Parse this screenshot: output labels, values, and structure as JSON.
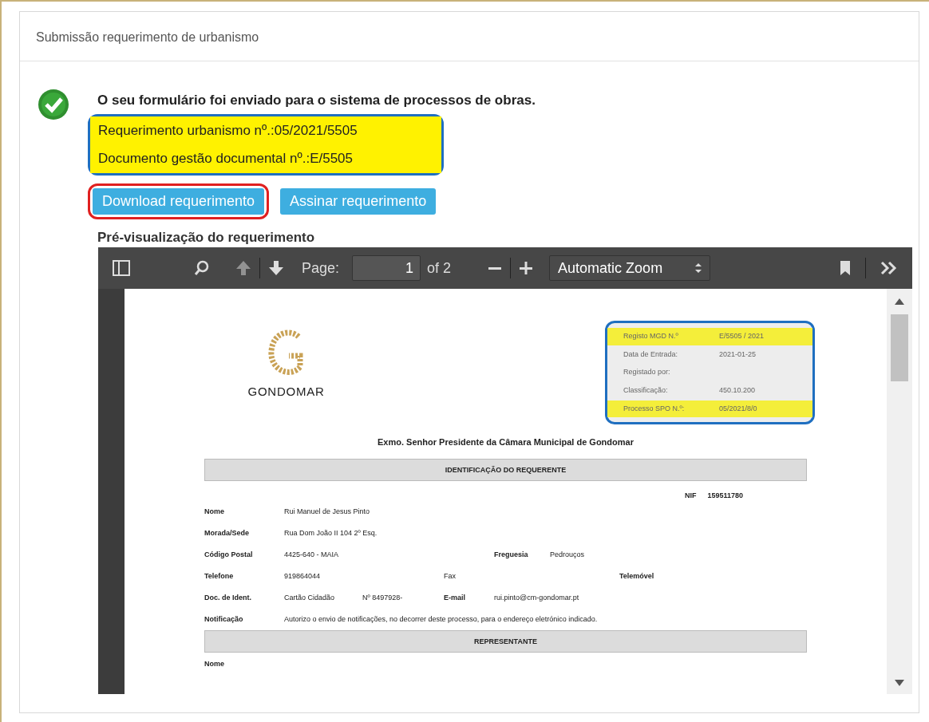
{
  "panel": {
    "title": "Submissão requerimento de urbanismo"
  },
  "result": {
    "message": "O seu formulário foi enviado para o sistema de processos de obras.",
    "references": [
      {
        "text": "Requerimento urbanismo nº.:05/2021/5505",
        "highlighted": true
      },
      {
        "text": "Documento gestão documental nº.:E/5505",
        "highlighted": true
      }
    ],
    "outlined": true
  },
  "buttons": [
    {
      "label": "Download requerimento",
      "outlined": true
    },
    {
      "label": "Assinar requerimento",
      "outlined": false
    }
  ],
  "preview": {
    "title": "Pré-visualização do requerimento",
    "toolbar": {
      "page_label": "Page:",
      "page": "1",
      "page_count": "of 2",
      "zoom": "Automatic Zoom"
    },
    "document": {
      "logo": "GONDOMAR",
      "registry": [
        {
          "label": "Registo MGD N.º",
          "value": "E/5505 / 2021",
          "highlighted": true
        },
        {
          "label": "Data de Entrada:",
          "value": "2021-01-25",
          "highlighted": false
        },
        {
          "label": "Registado por:",
          "highlighted": false
        },
        {
          "label": "Classificação:",
          "value": "450.10.200",
          "highlighted": false
        },
        {
          "label": "Processo SPO N.º:",
          "value": "05/2021/8/0",
          "highlighted": true
        }
      ],
      "registry_outlined": true,
      "addressee": "Exmo. Senhor Presidente da Câmara Municipal de Gondomar",
      "section_1": "IDENTIFICAÇÃO DO REQUERENTE",
      "nif": {
        "label": "NIF",
        "value": "159511780"
      },
      "rows": [
        [
          {
            "kind": "label",
            "text": "Nome"
          },
          {
            "kind": "value",
            "text": "Rui Manuel de Jesus Pinto"
          }
        ],
        [
          {
            "kind": "label",
            "text": "Morada/Sede"
          },
          {
            "kind": "value",
            "text": "Rua Dom João II 104 2º Esq."
          }
        ],
        [
          {
            "kind": "label",
            "text": "Código Postal"
          },
          {
            "kind": "value",
            "text": "4425-640 - MAIA"
          },
          null,
          null,
          {
            "kind": "label",
            "text": "Freguesia"
          },
          {
            "kind": "value",
            "text": "Pedrouços"
          }
        ],
        [
          {
            "kind": "label",
            "text": "Telefone"
          },
          {
            "kind": "value",
            "text": "919864044"
          },
          null,
          {
            "kind": "value",
            "text": "Fax"
          },
          null,
          null,
          {
            "kind": "label",
            "text": "Telemóvel"
          }
        ],
        [
          {
            "kind": "label",
            "text": "Doc. de Ident."
          },
          {
            "kind": "value",
            "text": "Cartão Cidadão"
          },
          {
            "kind": "value",
            "text": "Nº 8497928-"
          },
          {
            "kind": "label",
            "text": "E-mail"
          },
          {
            "kind": "value",
            "text": "rui.pinto@cm-gondomar.pt"
          }
        ],
        [
          {
            "kind": "label",
            "text": "Notificação"
          },
          {
            "kind": "value",
            "text": "Autorizo o envio de notificações, no decorrer deste processo, para o endereço eletrónico indicado."
          }
        ]
      ],
      "section_2": "REPRESENTANTE",
      "rows_2": [
        [
          {
            "kind": "label",
            "text": "Nome"
          }
        ]
      ]
    }
  }
}
